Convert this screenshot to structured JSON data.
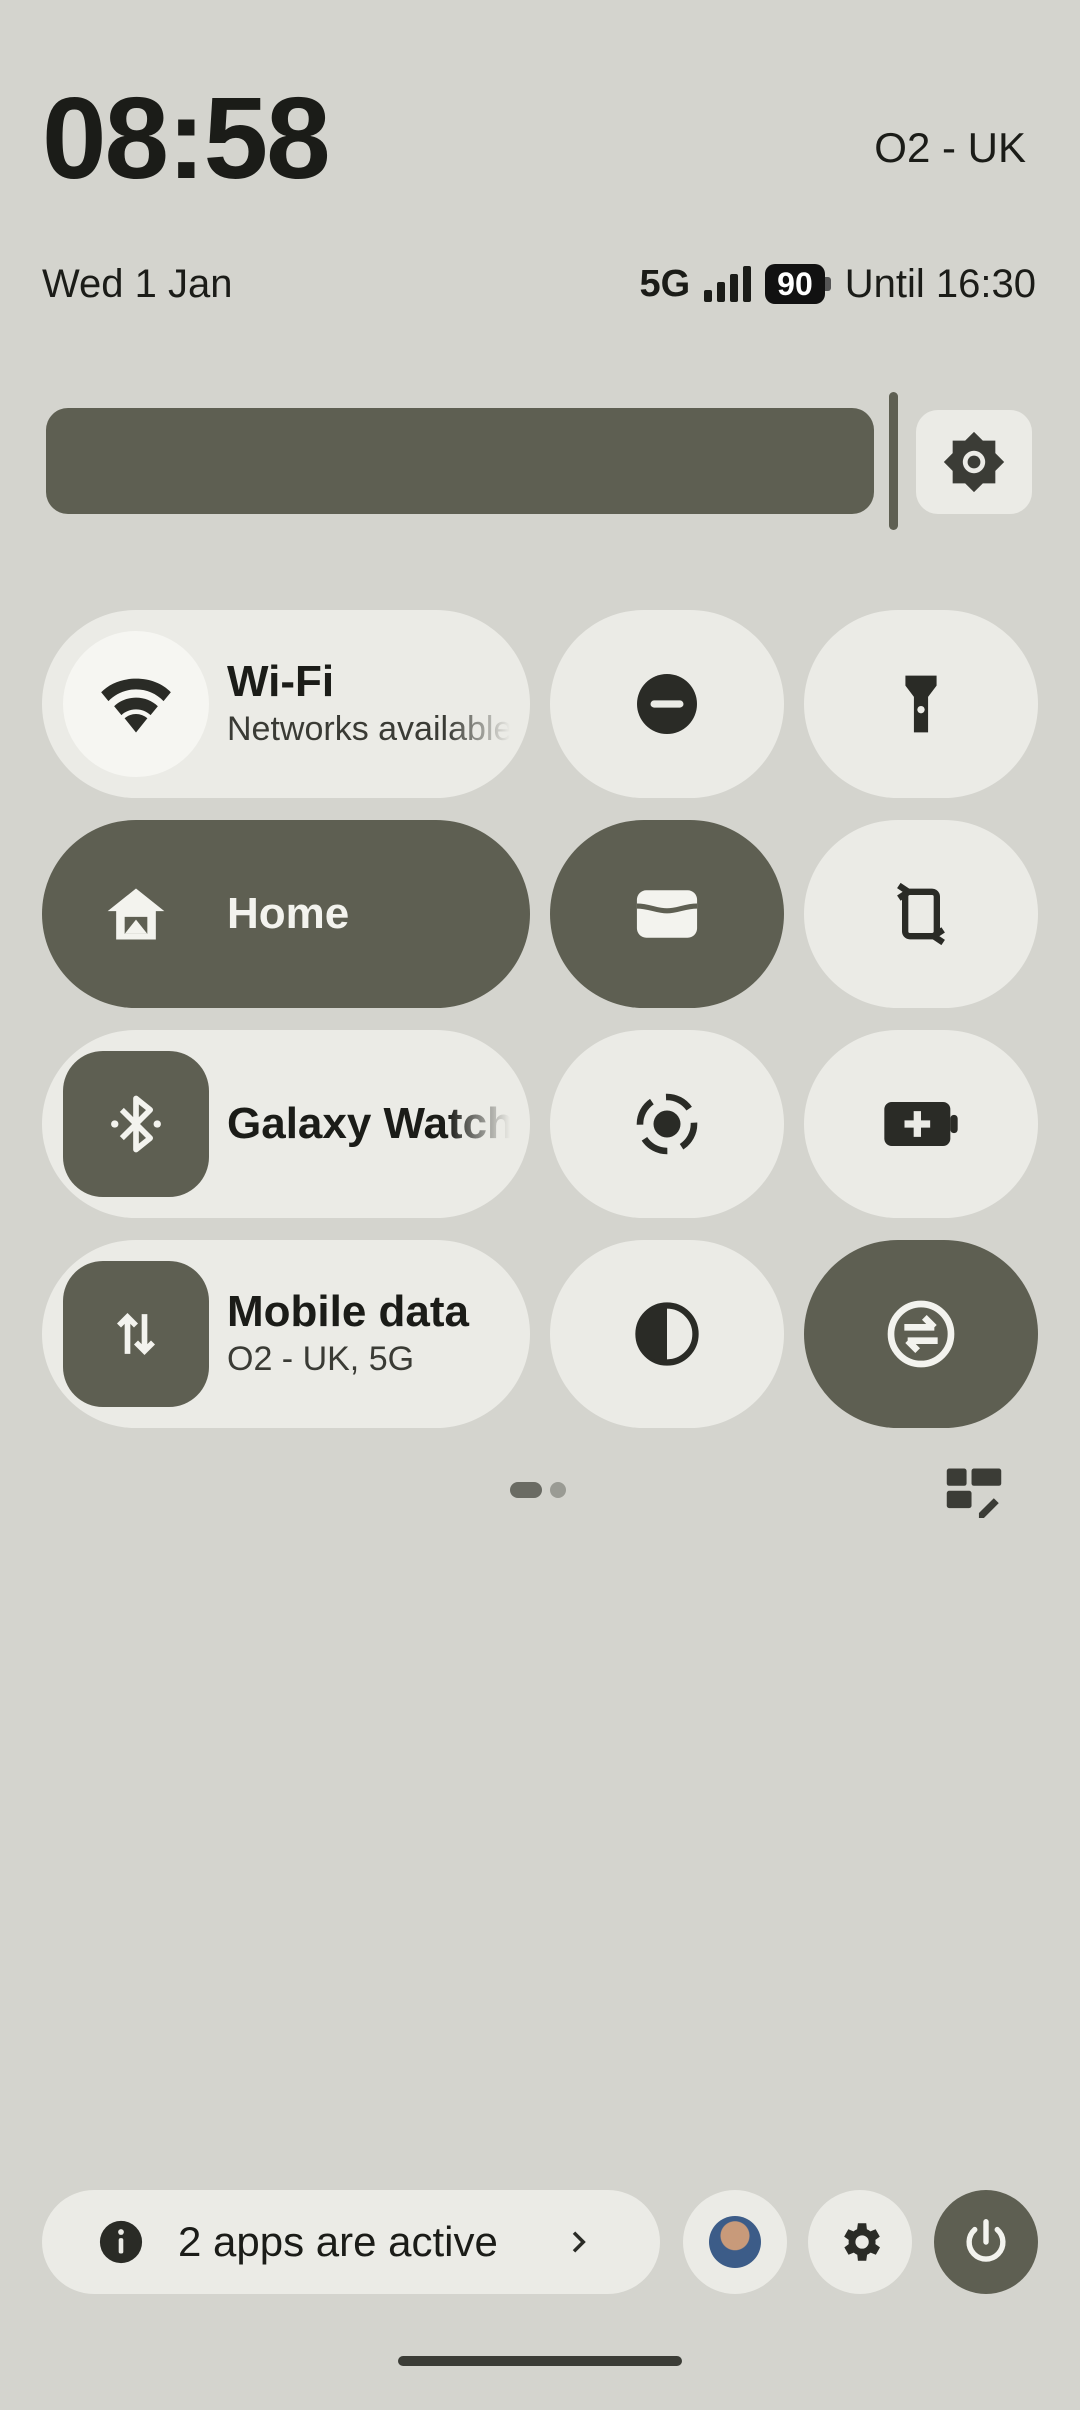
{
  "header": {
    "time": "08:58",
    "carrier": "O2 - UK",
    "date": "Wed 1 Jan",
    "network_type": "5G",
    "battery_level": "90",
    "battery_text": "Until 16:30",
    "signal_level": 4
  },
  "brightness": {
    "level": 0.86,
    "auto_icon": "brightness-settings-icon"
  },
  "tiles": {
    "wifi": {
      "title": "Wi-Fi",
      "subtitle": "Networks available",
      "icon": "wifi-icon",
      "state": "off"
    },
    "dnd": {
      "icon": "do-not-disturb-icon",
      "state": "off"
    },
    "flashlight": {
      "icon": "flashlight-icon",
      "state": "off"
    },
    "home": {
      "title": "Home",
      "icon": "home-icon",
      "state": "on"
    },
    "wallet": {
      "icon": "wallet-icon",
      "state": "on"
    },
    "rotate": {
      "icon": "auto-rotate-icon",
      "state": "off"
    },
    "bluetooth": {
      "title": "Galaxy Watch",
      "icon": "bluetooth-icon",
      "state": "on"
    },
    "screen_record": {
      "icon": "screen-record-icon",
      "state": "off"
    },
    "battery_saver": {
      "icon": "battery-saver-icon",
      "state": "off"
    },
    "mobile_data": {
      "title": "Mobile data",
      "subtitle": "O2 - UK, 5G",
      "icon": "mobile-data-icon",
      "state": "on"
    },
    "dark_theme": {
      "icon": "dark-theme-icon",
      "state": "off"
    },
    "data_saver": {
      "icon": "data-saver-icon",
      "state": "on"
    }
  },
  "pager": {
    "current": 1,
    "total": 2
  },
  "footer": {
    "active_apps": "2 apps are active",
    "icons": [
      "info-icon",
      "chevron-right-icon",
      "user-avatar",
      "settings-icon",
      "power-icon"
    ]
  },
  "colors": {
    "background": "#d4d4ce",
    "tile_on": "#5e5f52",
    "tile_off": "#ebebe6",
    "text": "#1b1c18"
  }
}
